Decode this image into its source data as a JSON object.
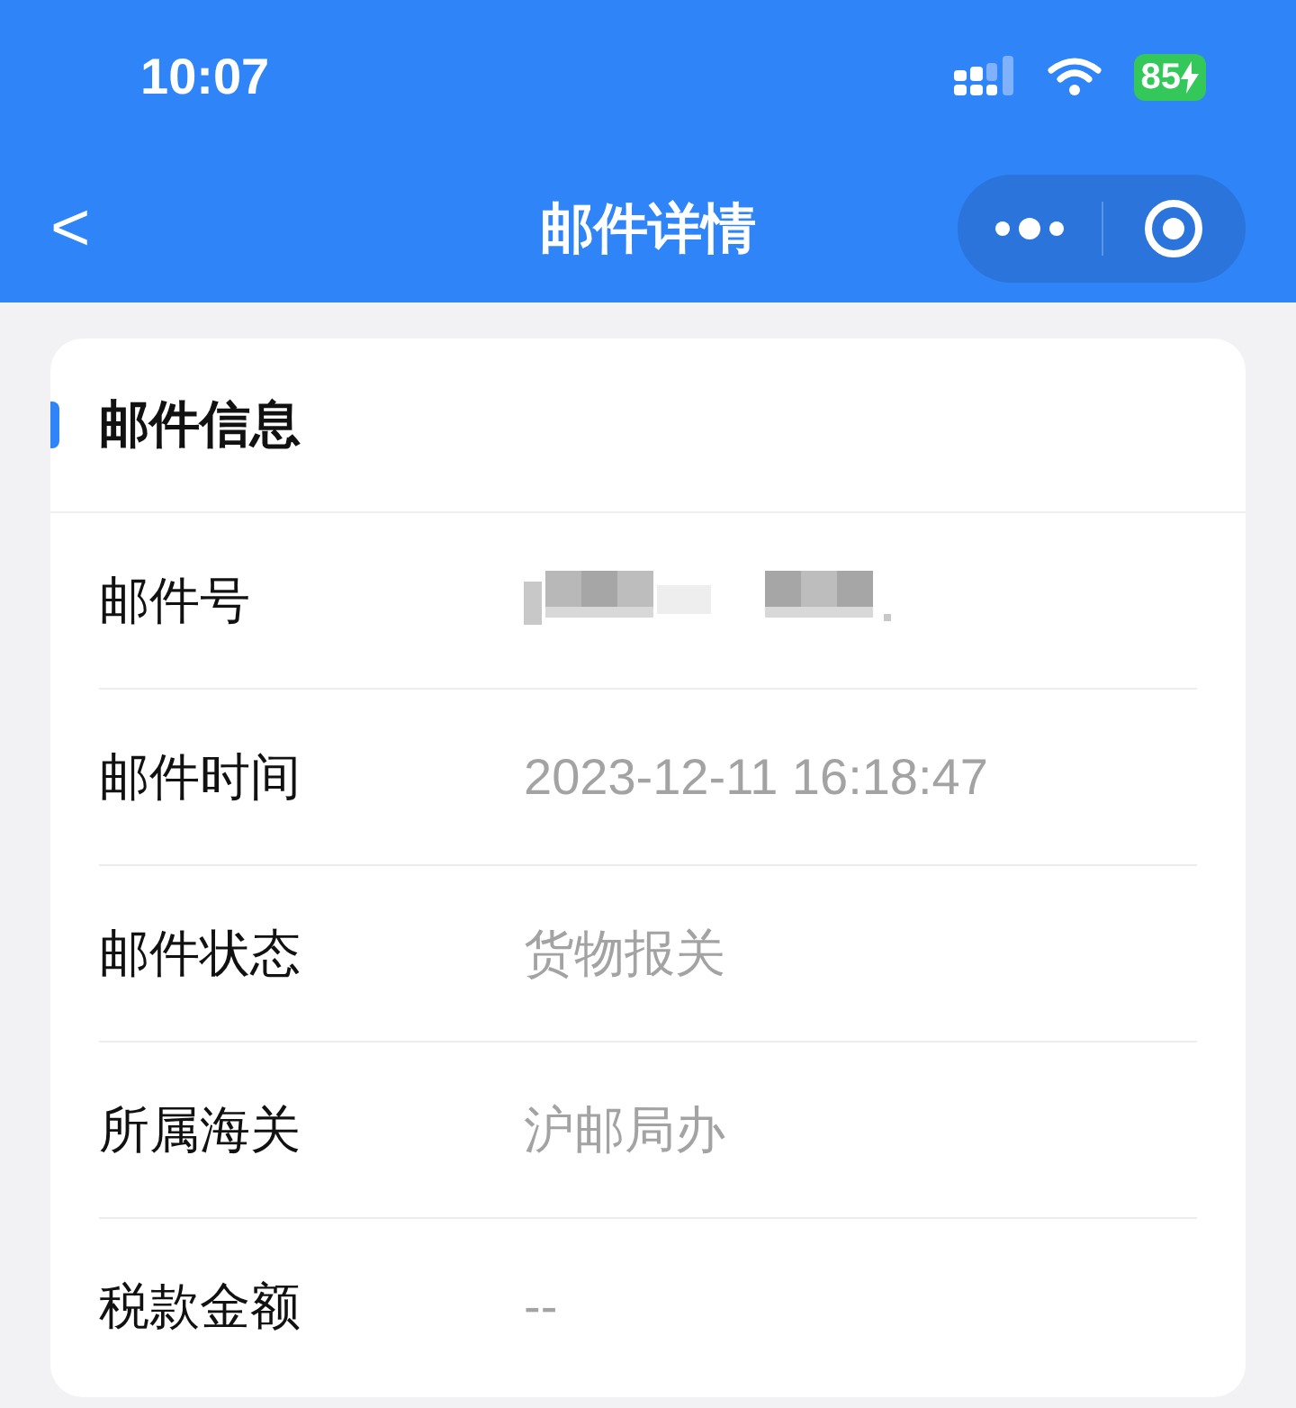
{
  "status_bar": {
    "time": "10:07",
    "battery": "85"
  },
  "nav_bar": {
    "back": "<",
    "title": "邮件详情"
  },
  "section": {
    "title": "邮件信息"
  },
  "rows": [
    {
      "label": "邮件号",
      "kind": "redacted"
    },
    {
      "label": "邮件时间",
      "kind": "text",
      "value": "2023-12-11 16:18:47"
    },
    {
      "label": "邮件状态",
      "kind": "text",
      "value": "货物报关"
    },
    {
      "label": "所属海关",
      "kind": "text",
      "value": "沪邮局办"
    },
    {
      "label": "税款金额",
      "kind": "text",
      "value": "--"
    }
  ]
}
